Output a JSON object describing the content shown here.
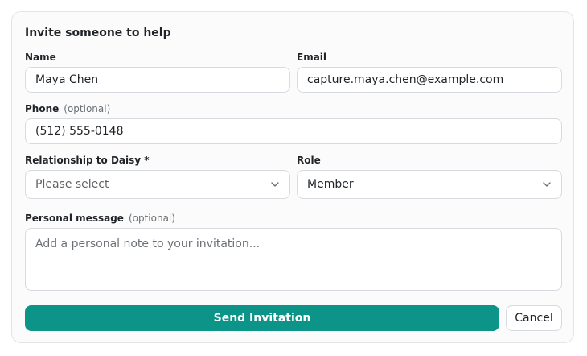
{
  "form": {
    "title": "Invite someone to help",
    "name": {
      "label": "Name",
      "value": "Maya Chen"
    },
    "email": {
      "label": "Email",
      "value": "capture.maya.chen@example.com"
    },
    "phone": {
      "label": "Phone",
      "optional": "(optional)",
      "value": "(512) 555-0148"
    },
    "relationship": {
      "label": "Relationship to Daisy *",
      "value": "Please select"
    },
    "role": {
      "label": "Role",
      "value": "Member"
    },
    "message": {
      "label": "Personal message",
      "optional": "(optional)",
      "placeholder": "Add a personal note to your invitation..."
    },
    "send_label": "Send Invitation",
    "cancel_label": "Cancel"
  },
  "colors": {
    "primary": "#0c9488",
    "border": "#d7dade",
    "card_background": "#fbfbfb"
  },
  "icons": {
    "select_chevron": "chevron-down-icon"
  }
}
